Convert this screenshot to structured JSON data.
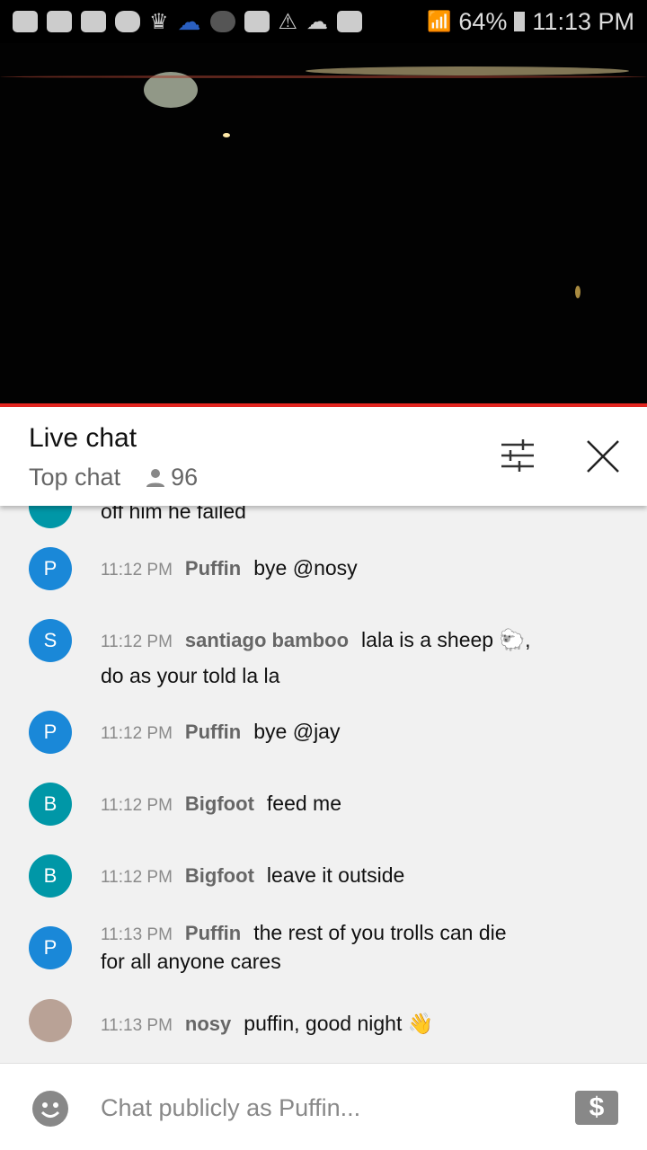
{
  "status_bar": {
    "battery": "64%",
    "time": "11:13 PM",
    "icons": [
      "message-icon",
      "youtube-icon",
      "youtube-icon",
      "m-app-icon",
      "crown-icon",
      "cloud-outline-icon",
      "m-app-icon",
      "folder-icon",
      "warning-icon",
      "cloud-icon",
      "image-icon",
      "wifi-icon",
      "signal-icon",
      "battery-icon"
    ]
  },
  "header": {
    "title": "Live chat",
    "mode": "Top chat",
    "viewer_count": "96"
  },
  "messages": [
    {
      "initial": "",
      "time": "",
      "author": "",
      "text": "off him he failed",
      "color": "#0097a7"
    },
    {
      "initial": "P",
      "time": "11:12 PM",
      "author": "Puffin",
      "text": "bye @nosy",
      "color": "#1a88d8"
    },
    {
      "initial": "S",
      "time": "11:12 PM",
      "author": "santiago bamboo",
      "text": "lala is a sheep 🐑,",
      "text2": "do as your told la la",
      "color": "#1a88d8"
    },
    {
      "initial": "P",
      "time": "11:12 PM",
      "author": "Puffin",
      "text": "bye @jay",
      "color": "#1a88d8"
    },
    {
      "initial": "B",
      "time": "11:12 PM",
      "author": "Bigfoot",
      "text": "feed me",
      "color": "#0097a7"
    },
    {
      "initial": "B",
      "time": "11:12 PM",
      "author": "Bigfoot",
      "text": "leave it outside",
      "color": "#0097a7"
    },
    {
      "initial": "P",
      "time": "11:13 PM",
      "author": "Puffin",
      "text": "the rest of you trolls can die",
      "text2": "for all anyone cares",
      "color": "#1a88d8"
    },
    {
      "initial": "",
      "time": "11:13 PM",
      "author": "nosy",
      "text": "puffin, good night 👋",
      "color": "#b9a296"
    }
  ],
  "input": {
    "placeholder": "Chat publicly as Puffin...",
    "superchat": "$"
  }
}
